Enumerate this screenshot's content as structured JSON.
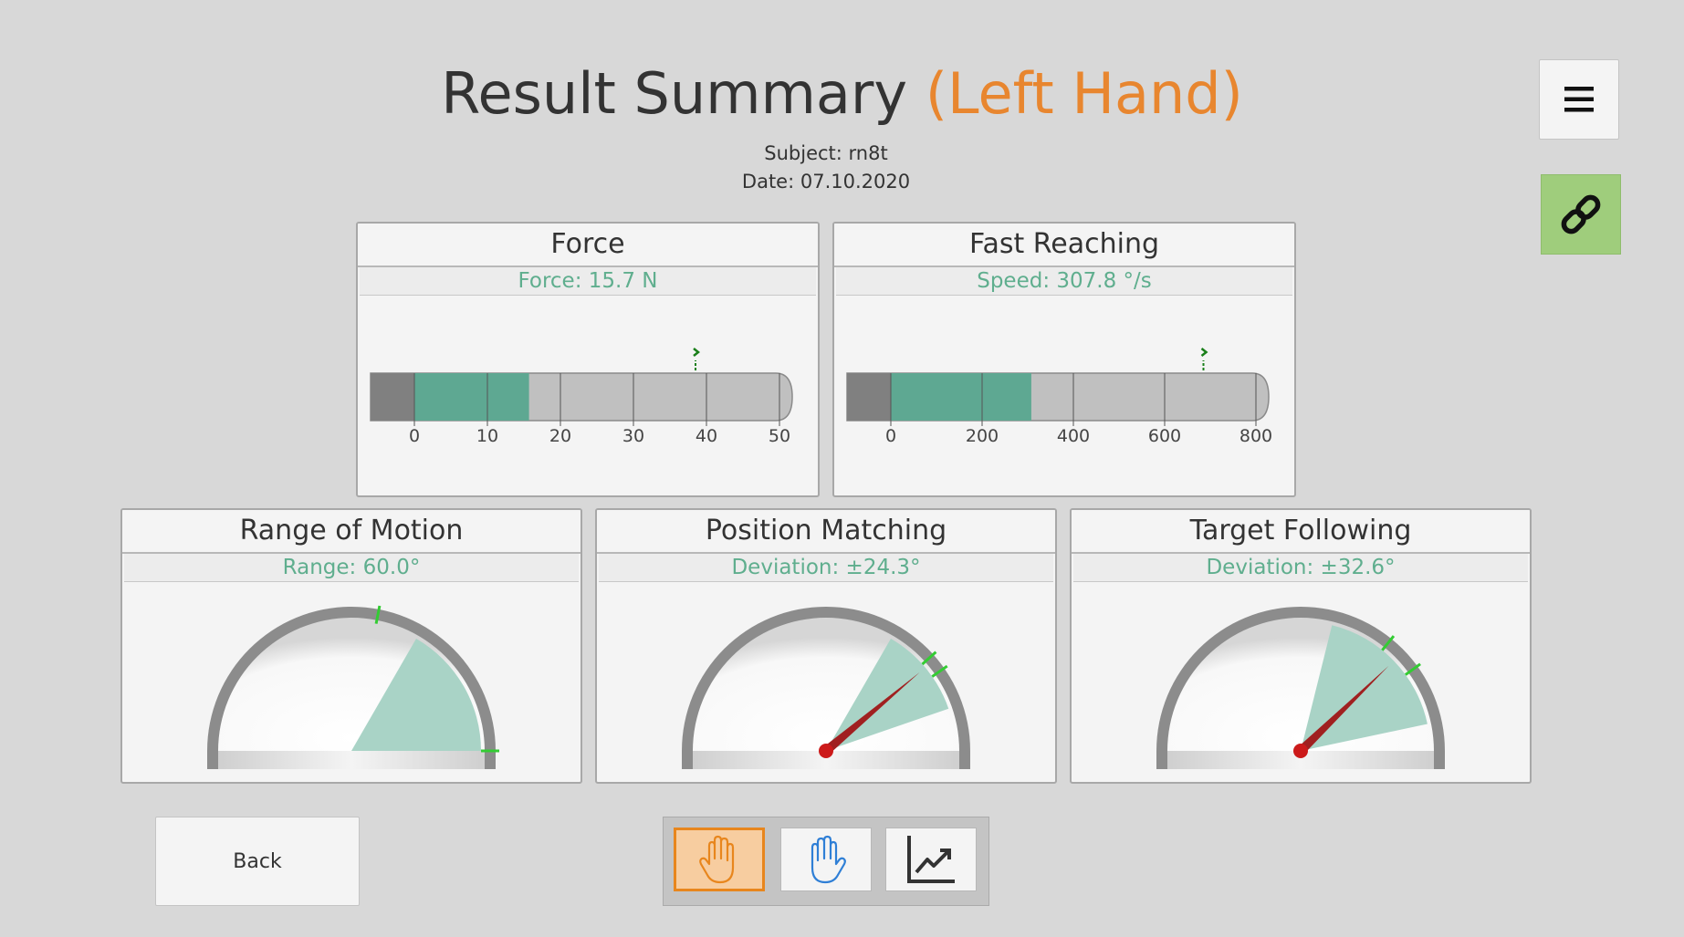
{
  "header": {
    "title": "Result Summary",
    "hand": "(Left Hand)",
    "subject": "Subject: rn8t",
    "date": "Date: 07.10.2020"
  },
  "toolbar_right": {
    "menu_icon": "hamburger-menu-icon",
    "link_icon": "link-chain-icon"
  },
  "colors": {
    "background": "#d8d8d8",
    "accent_orange": "#e8862f",
    "value_green": "#5fae8e",
    "bar_fill": "#5ea892",
    "gauge_fill": "#a9d3c6",
    "link_button": "#9fcd7c",
    "needle": "#a02020"
  },
  "panels": {
    "force": {
      "title": "Force",
      "value": "Force: 15.7 N",
      "bar": {
        "min": 0,
        "max": 50,
        "value": 15.7,
        "marker": 38.5,
        "ticks": [
          "0",
          "10",
          "20",
          "30",
          "40",
          "50"
        ]
      }
    },
    "fast_reaching": {
      "title": "Fast Reaching",
      "value": "Speed: 307.8 °/s",
      "bar": {
        "min": 0,
        "max": 800,
        "value": 307.8,
        "marker": 685,
        "ticks": [
          "0",
          "200",
          "400",
          "600",
          "800"
        ]
      }
    },
    "range_of_motion": {
      "title": "Range of Motion",
      "value": "Range: 60.0°",
      "gauge": {
        "sector_from_deg": 0,
        "sector_to_deg": 60,
        "needle_deg": null,
        "marker_deg": [
          0,
          79
        ]
      }
    },
    "position_matching": {
      "title": "Position Matching",
      "value": "Deviation: ±24.3°",
      "gauge": {
        "sector_from_deg": 19,
        "sector_to_deg": 60,
        "needle_deg": 40,
        "marker_deg": [
          35,
          42
        ]
      }
    },
    "target_following": {
      "title": "Target Following",
      "value": "Deviation: ±32.6°",
      "gauge": {
        "sector_from_deg": 12,
        "sector_to_deg": 76,
        "needle_deg": 44,
        "marker_deg": [
          36,
          51
        ]
      }
    }
  },
  "footer": {
    "back_label": "Back",
    "left_hand_icon": "left-hand-icon",
    "right_hand_icon": "right-hand-icon",
    "chart_icon": "line-chart-icon"
  }
}
